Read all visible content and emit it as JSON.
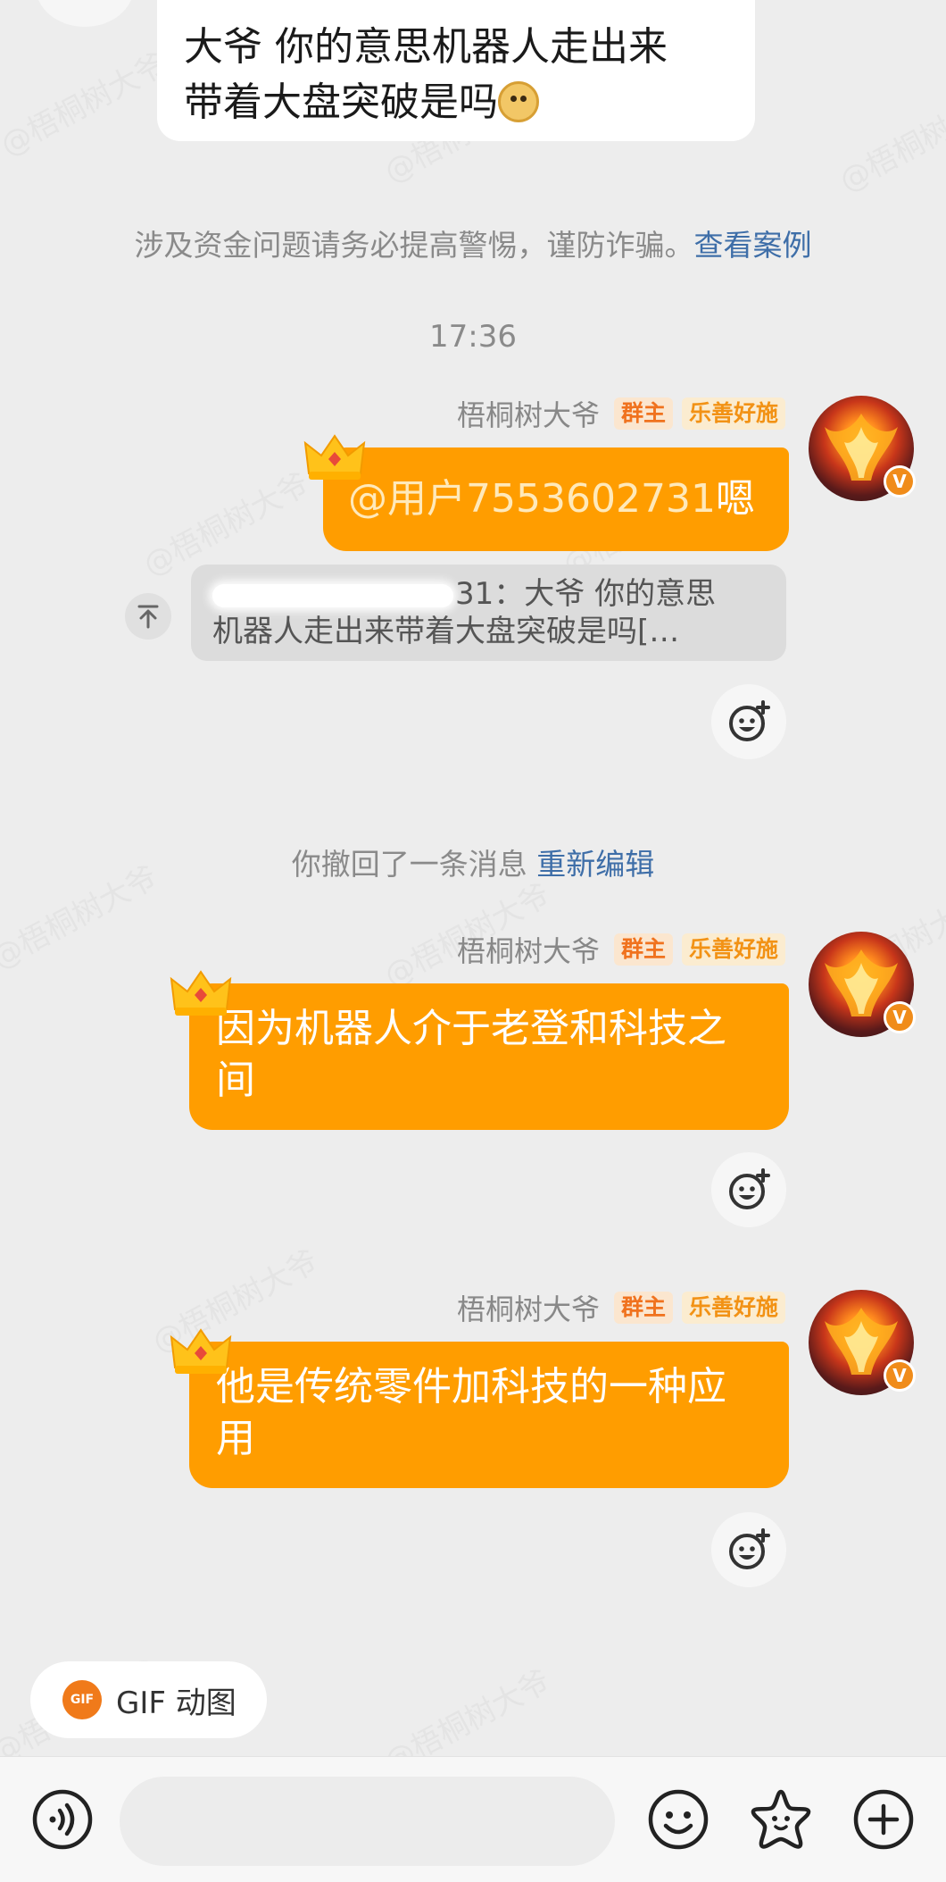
{
  "watermark_text": "@梧桐树大爷",
  "top_message": {
    "line1": "大爷 你的意思机器人走出来",
    "line2": "带着大盘突破是吗",
    "emoji_icon": "dog-face-emoji"
  },
  "security_notice": {
    "text": "涉及资金问题请务必提高警惕，谨防诈骗。",
    "link": "查看案例"
  },
  "timestamp": "17:36",
  "sender": {
    "name": "梧桐树大爷",
    "badge_owner": "群主",
    "badge_title": "乐善好施"
  },
  "messages": [
    {
      "mention": "@用户7553602731",
      "text": "嗯",
      "quote": {
        "visible_suffix": "31：大爷 你的意思",
        "line2": "机器人走出来带着大盘突破是吗[…"
      }
    },
    {
      "line1": "因为机器人介于老登和科技之",
      "line2": "间"
    },
    {
      "line1": "他是传统零件加科技的一种应",
      "line2": "用"
    }
  ],
  "recall_notice": {
    "text": "你撤回了一条消息",
    "link": "重新编辑"
  },
  "gif_button": {
    "label": "GIF 动图",
    "logo": "GIF"
  },
  "input_bar": {
    "voice_icon": "voice-icon",
    "emoji_icon": "smile-icon",
    "sticker_icon": "star-sticker-icon",
    "plus_icon": "plus-icon"
  },
  "colors": {
    "bubble": "#ff9d00",
    "link": "#3e6ea8",
    "background": "#ededed"
  }
}
